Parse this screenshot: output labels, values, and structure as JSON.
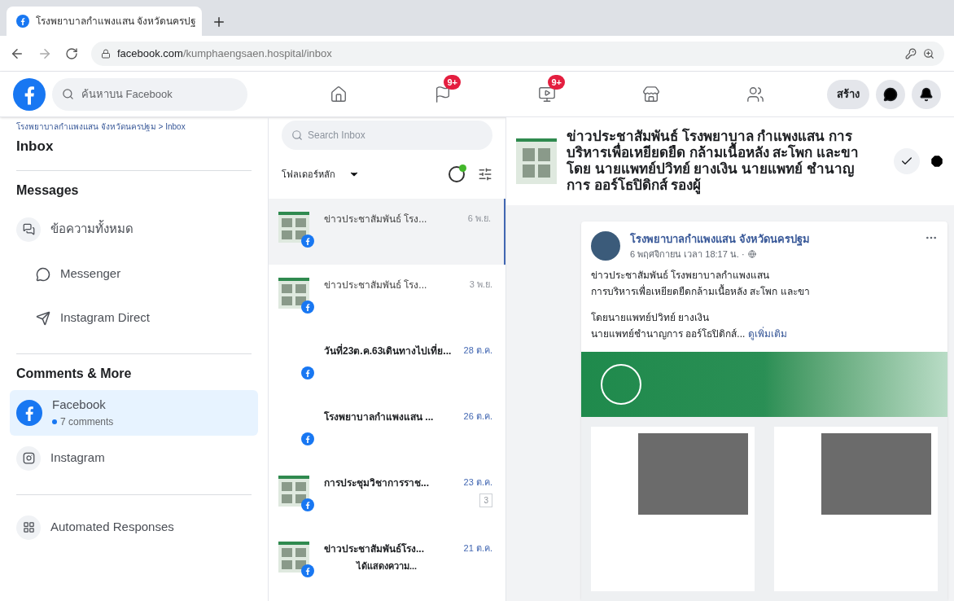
{
  "browser": {
    "tab_title": "โรงพยาบาลกำแพงแสน จังหวัดนครปฐ",
    "url_domain": "facebook.com",
    "url_path": "/kumphaengsaen.hospital/inbox"
  },
  "header": {
    "search_placeholder": "ค้นหาบน Facebook",
    "nav": [
      {
        "selected": false
      },
      {
        "badge": "9+",
        "selected": false
      },
      {
        "badge": "9+",
        "selected": false
      },
      {
        "selected": false
      },
      {
        "selected": false
      }
    ],
    "create_label": "สร้าง"
  },
  "sidebar": {
    "breadcrumb": "โรงพยาบาลกำแพงแสน จังหวัดนครปฐม > Inbox",
    "title": "Inbox",
    "sections": [
      {
        "heading": "Messages",
        "items": [
          {
            "label": "ข้อความทั้งหมด",
            "kind": "main",
            "selected": false
          },
          {
            "label": "Messenger",
            "kind": "sub",
            "selected": false
          },
          {
            "label": "Instagram Direct",
            "kind": "sub",
            "selected": false
          }
        ]
      },
      {
        "heading": "Comments & More",
        "items": [
          {
            "label": "Facebook",
            "subtitle": "7 comments",
            "kind": "main",
            "selected": true
          },
          {
            "label": "Instagram",
            "kind": "main",
            "selected": false
          }
        ]
      },
      {
        "items": [
          {
            "label": "Automated Responses",
            "kind": "main",
            "selected": false
          }
        ]
      }
    ]
  },
  "inbox": {
    "search_placeholder": "Search Inbox",
    "folder": "โฟลเดอร์หลัก",
    "conversations": [
      {
        "title": "ข่าวประชาสัมพันธ์ โรง...",
        "date": "6 พ.ย.",
        "selected": true,
        "unread": false,
        "thumbnail": true
      },
      {
        "title": "ข่าวประชาสัมพันธ์ โรง...",
        "date": "3 พ.ย.",
        "selected": false,
        "unread": false,
        "thumbnail": true
      },
      {
        "title": "วันที่23ต.ค.63เดินทางไปเที่ย...",
        "date": "28 ต.ค.",
        "selected": false,
        "unread": true,
        "thumbnail": false
      },
      {
        "title": "โรงพยาบาลกำแพงแสน ...",
        "date": "26 ต.ค.",
        "selected": false,
        "unread": true,
        "thumbnail": false
      },
      {
        "title": "การประชุมวิชาการราช...",
        "date": "23 ต.ค.",
        "count": "3",
        "selected": false,
        "unread": true,
        "thumbnail": true
      },
      {
        "title": "ข่าวประชาสัมพันธ์โรง...",
        "date": "21 ต.ค.",
        "snippet": "ได้แสดงความ...",
        "selected": false,
        "unread": true,
        "thumbnail": true
      }
    ]
  },
  "detail": {
    "title": "ข่าวประชาสัมพันธ์ โรงพยาบาล กำแพงแสน การบริหารเพื่อเหยียดยืด กล้ามเนื้อหลัง สะโพก และขา โดย นายแพทย์ปวิทย์ ยางเงิน นายแพทย์ ชำนาญการ ออร์โธปิดิกส์ รองผู้",
    "post": {
      "author": "โรงพยาบาลกำแพงแสน จังหวัดนครปฐม",
      "time": "6 พฤศจิกายน เวลา 18:17 น. ·",
      "paragraphs": [
        "ข่าวประชาสัมพันธ์ โรงพยาบาลกำแพงแสน\nการบริหารเพื่อเหยียดยืดกล้ามเนื้อหลัง สะโพก และขา",
        "โดยนายแพทย์ปวิทย์ ยางเงิน\nนายแพทย์ชำนาญการ ออร์โธปิดิกส์..."
      ],
      "see_more": "ดูเพิ่มเติม"
    }
  }
}
